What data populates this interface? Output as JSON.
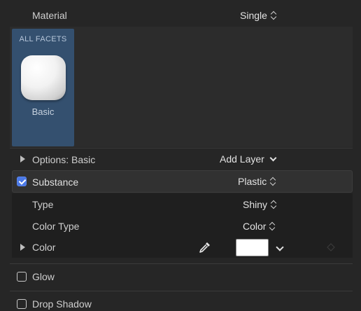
{
  "header": {
    "material_label": "Material",
    "material_value": "Single"
  },
  "facet": {
    "tab_label": "ALL FACETS",
    "item_label": "Basic"
  },
  "options": {
    "label": "Options: Basic",
    "add_layer": "Add Layer"
  },
  "substance": {
    "label": "Substance",
    "value": "Plastic",
    "checked": true
  },
  "type": {
    "label": "Type",
    "value": "Shiny"
  },
  "color_type": {
    "label": "Color Type",
    "value": "Color"
  },
  "color": {
    "label": "Color",
    "swatch_color": "#ffffff"
  },
  "glow": {
    "label": "Glow",
    "checked": false
  },
  "drop_shadow": {
    "label": "Drop Shadow",
    "checked": false
  },
  "colors": {
    "accent": "#4a78e6",
    "facet_panel": "#34506f",
    "panel_bg": "#262626"
  }
}
